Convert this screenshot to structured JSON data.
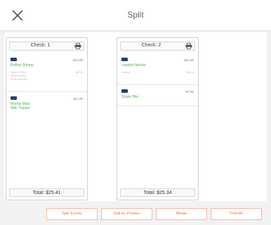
{
  "header": {
    "title": "Split",
    "close_icon": "close-icon"
  },
  "checks": [
    {
      "name": "Check: 1",
      "printer_icon": "printer-icon",
      "items": [
        {
          "seat_color": "#2c3e6e",
          "name": "Buffalo Shrimp",
          "price": "$12.99",
          "modifier": "SAUCE ON\nSEASONED\nBLACKENED",
          "modifier_price": "$0.00"
        },
        {
          "seat_color": "#2c3e6e",
          "name": "Bloody Mary\nWith Tequila",
          "price": "$11.00",
          "modifier": "",
          "modifier_price": ""
        }
      ],
      "total": "Total: $25.41"
    },
    {
      "name": "Check: 2",
      "printer_icon": "printer-icon",
      "items": [
        {
          "seat_color": "#2c3e6e",
          "name": "Loaded Nachos",
          "price": "$11.49",
          "modifier": "Queso",
          "modifier_price": "$0.00"
        },
        {
          "seat_color": "#2c3e6e",
          "name": "Shake Bite",
          "price": "$7.50",
          "modifier": "",
          "modifier_price": ""
        }
      ],
      "total": "Total: $25.34"
    }
  ],
  "actions": {
    "split_evenly": "Split Evenly",
    "split_by_position": "Split by Position",
    "merge": "Merge",
    "print_all": "Print All"
  },
  "colors": {
    "accent": "#e07a5f",
    "item_name": "#4caf50",
    "seat_tag": "#2c3e6e"
  }
}
